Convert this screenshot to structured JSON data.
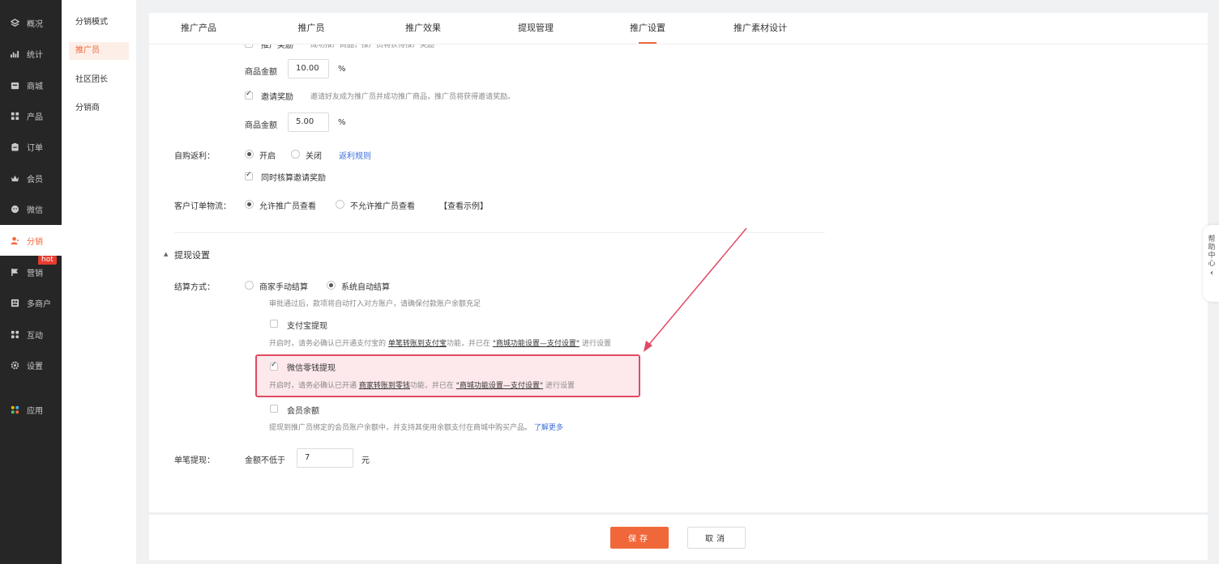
{
  "sidenav": {
    "items": [
      {
        "label": "概况",
        "icon": "layers-icon"
      },
      {
        "label": "统计",
        "icon": "chart-icon"
      },
      {
        "label": "商城",
        "icon": "store-icon"
      },
      {
        "label": "产品",
        "icon": "grid-icon"
      },
      {
        "label": "订单",
        "icon": "clipboard-icon"
      },
      {
        "label": "会员",
        "icon": "crown-icon"
      },
      {
        "label": "微信",
        "icon": "wechat-icon"
      },
      {
        "label": "分销",
        "icon": "user-share-icon"
      },
      {
        "label": "营销",
        "icon": "flag-icon"
      },
      {
        "label": "多商户",
        "icon": "shop-icon"
      },
      {
        "label": "互动",
        "icon": "apps-icon"
      },
      {
        "label": "设置",
        "icon": "gear-icon"
      },
      {
        "label": "应用",
        "icon": "colorful-apps-icon"
      }
    ],
    "hot_badge": "hot"
  },
  "subnav": {
    "items": [
      "分销模式",
      "推广员",
      "社区团长",
      "分销商"
    ]
  },
  "tabs": [
    "推广产品",
    "推广员",
    "推广效果",
    "提现管理",
    "推广设置",
    "推广素材设计"
  ],
  "form": {
    "top_cut_label": "推广奖励",
    "top_cut_hint": "成功推广商品，推广员将获得推广奖励",
    "amount_label_1": "商品金额",
    "amount_value_1": "10.00",
    "percent": "%",
    "invite_reward_label": "邀请奖励",
    "invite_reward_hint": "邀请好友成为推广员并成功推广商品，推广员将获得邀请奖励。",
    "amount_label_2": "商品金额",
    "amount_value_2": "5.00",
    "self_purchase_label": "自购返利：",
    "on_label": "开启",
    "off_label": "关闭",
    "rebate_rules_link": "返利规则",
    "calc_invite_label": "同时核算邀请奖励",
    "logistics_label": "客户订单物流：",
    "allow_label": "允许推广员查看",
    "disallow_label": "不允许推广员查看",
    "view_example": "【查看示例】",
    "withdraw_section": "提现设置",
    "settle_label": "结算方式：",
    "manual_settle": "商家手动结算",
    "auto_settle": "系统自动结算",
    "auto_hint": "审批通过后，款项将自动打入对方账户，请确保付款账户余额充足",
    "alipay_label": "支付宝提现",
    "alipay_hint_pre": "开启时，请务必确认已开通支付宝的",
    "alipay_hint_link": "单笔转账到支付宝",
    "alipay_hint_mid": "功能，并已在",
    "alipay_hint_link2": "\"商城功能设置—支付设置\"",
    "alipay_hint_post": "进行设置",
    "wechat_label": "微信零钱提现",
    "wechat_hint_pre": "开启时，请务必确认已开通",
    "wechat_hint_link": "商家转账到零钱",
    "wechat_hint_mid": "功能，并已在",
    "wechat_hint_link2": "\"商城功能设置—支付设置\"",
    "wechat_hint_post": "进行设置",
    "balance_label": "会员余额",
    "balance_hint": "提现到推广员绑定的会员账户余额中，并支持其使用余额支付在商城中购买产品。",
    "learn_more": "了解更多",
    "single_withdraw_label": "单笔提现：",
    "min_amount_label": "金额不低于",
    "min_amount_value": "7",
    "yuan": "元"
  },
  "footer": {
    "save": "保存",
    "cancel": "取消"
  },
  "help_center": "帮助中心",
  "colors": {
    "accent": "#f0683a",
    "highlight_border": "#e14a63",
    "annotation_arrow": "#e14a63"
  }
}
